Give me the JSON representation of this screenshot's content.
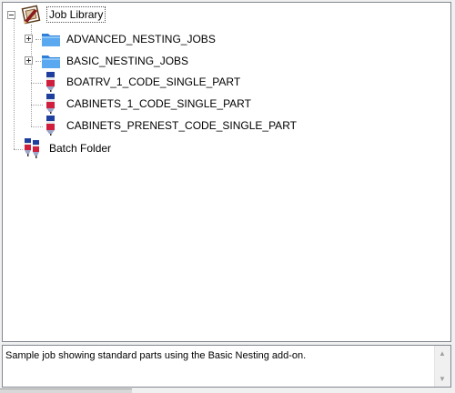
{
  "tree": {
    "root": {
      "label": "Job Library",
      "icon": "job-library-icon",
      "expanded": true
    },
    "children": [
      {
        "label": "ADVANCED_NESTING_JOBS",
        "icon": "folder-icon",
        "expandable": true
      },
      {
        "label": "BASIC_NESTING_JOBS",
        "icon": "folder-icon",
        "expandable": true
      },
      {
        "label": "BOATRV_1_CODE_SINGLE_PART",
        "icon": "job-marker-icon",
        "expandable": false
      },
      {
        "label": "CABINETS_1_CODE_SINGLE_PART",
        "icon": "job-marker-icon",
        "expandable": false
      },
      {
        "label": "CABINETS_PRENEST_CODE_SINGLE_PART",
        "icon": "job-marker-icon",
        "expandable": false
      }
    ],
    "batch": {
      "label": "Batch Folder",
      "icon": "batch-folder-icon"
    }
  },
  "description": {
    "text": "Sample job showing standard parts using the Basic Nesting add-on."
  },
  "colors": {
    "folder": "#3a8ee6",
    "marker_blue": "#1f3f9e",
    "marker_red": "#d01f3c",
    "border": "#828790"
  }
}
